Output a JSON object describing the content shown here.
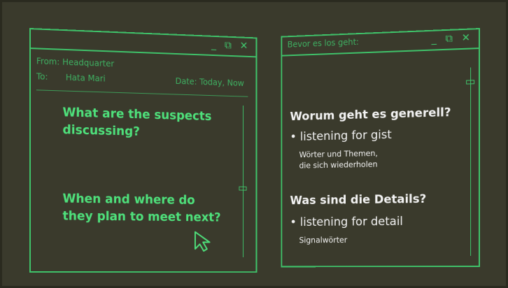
{
  "left_window": {
    "controls": "_ ❐ ✕",
    "from_label": "From:",
    "from_value": "Headquarter",
    "to_label": "To:",
    "to_value": "Hata Mari",
    "date_label": "Date:",
    "date_value": "Today, Now",
    "question_1": "What are the suspects discussing?",
    "question_2": "When and where do they plan to meet next?"
  },
  "right_window": {
    "title": "Bevor es los geht:",
    "controls": "_ ❐ ✕",
    "heading_1": "Worum geht es generell?",
    "bullet_1": "• listening for gist",
    "sub_1a": "Wörter und Themen,",
    "sub_1b": "die sich wiederholen",
    "heading_2": "Was sind die Details?",
    "bullet_2": "• listening for detail",
    "sub_2": "Signalwörter"
  },
  "icons": {
    "cursor": "cursor-arrow-icon",
    "minimize": "minimize-icon",
    "restore": "restore-icon",
    "close": "close-icon"
  },
  "colors": {
    "background": "#3a3a2c",
    "accent": "#3fc36a",
    "accent_bright": "#4ee07b",
    "text_light": "#f2f2f2"
  }
}
